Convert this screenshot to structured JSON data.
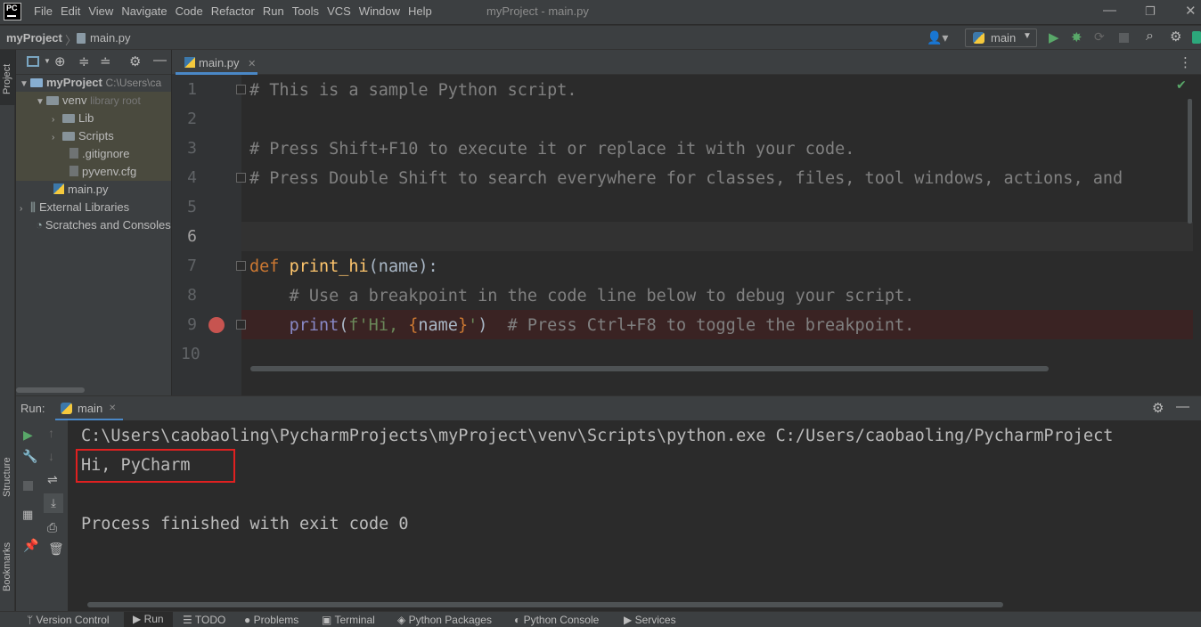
{
  "menubar": {
    "logo_text": "PC",
    "items": [
      "File",
      "Edit",
      "View",
      "Navigate",
      "Code",
      "Refactor",
      "Run",
      "Tools",
      "VCS",
      "Window",
      "Help"
    ],
    "window_title": "myProject - main.py"
  },
  "navbar": {
    "project": "myProject",
    "separator": "〉",
    "file": "main.py",
    "run_config": "main"
  },
  "sidebar_strip": {
    "project_label": "Project",
    "structure_label": "Structure",
    "bookmarks_label": "Bookmarks"
  },
  "project_tree": {
    "root_name": "myProject",
    "root_path": "C:\\Users\\ca",
    "venv": "venv",
    "venv_hint": "library root",
    "lib": "Lib",
    "scripts": "Scripts",
    "gitignore": ".gitignore",
    "pyvenv": "pyvenv.cfg",
    "mainpy": "main.py",
    "external": "External Libraries",
    "scratches": "Scratches and Consoles"
  },
  "editor": {
    "tab_label": "main.py",
    "line_numbers": [
      "1",
      "2",
      "3",
      "4",
      "5",
      "6",
      "7",
      "8",
      "9",
      "10"
    ],
    "line1": "# This is a sample Python script.",
    "line3": "# Press Shift+F10 to execute it or replace it with your code.",
    "line4": "# Press Double Shift to search everywhere for classes, files, tool windows, actions, and",
    "line7_kw": "def",
    "line7_fn": "print_hi",
    "line7_rest": "(name):",
    "line8": "    # Use a breakpoint in the code line below to debug your script.",
    "line9_indent": "    ",
    "line9_print": "print",
    "line9_open": "(",
    "line9_str1": "f'Hi, ",
    "line9_brace_open": "{",
    "line9_name": "name",
    "line9_brace_close": "}",
    "line9_str2": "'",
    "line9_close": ")",
    "line9_comment": "  # Press Ctrl+F8 to toggle the breakpoint."
  },
  "run_panel": {
    "label": "Run:",
    "tab": "main",
    "output_cmd": "C:\\Users\\caobaoling\\PycharmProjects\\myProject\\venv\\Scripts\\python.exe C:/Users/caobaoling/PycharmProject",
    "output_hi": "Hi, PyCharm",
    "output_exit": "Process finished with exit code 0"
  },
  "statusbar": {
    "items": [
      "Version Control",
      "Run",
      "TODO",
      "Problems",
      "Terminal",
      "Python Packages",
      "Python Console",
      "Services"
    ]
  },
  "colors": {
    "highlight_box": "#e02020",
    "breakpoint": "#c75450",
    "accent": "#4a88c7"
  }
}
